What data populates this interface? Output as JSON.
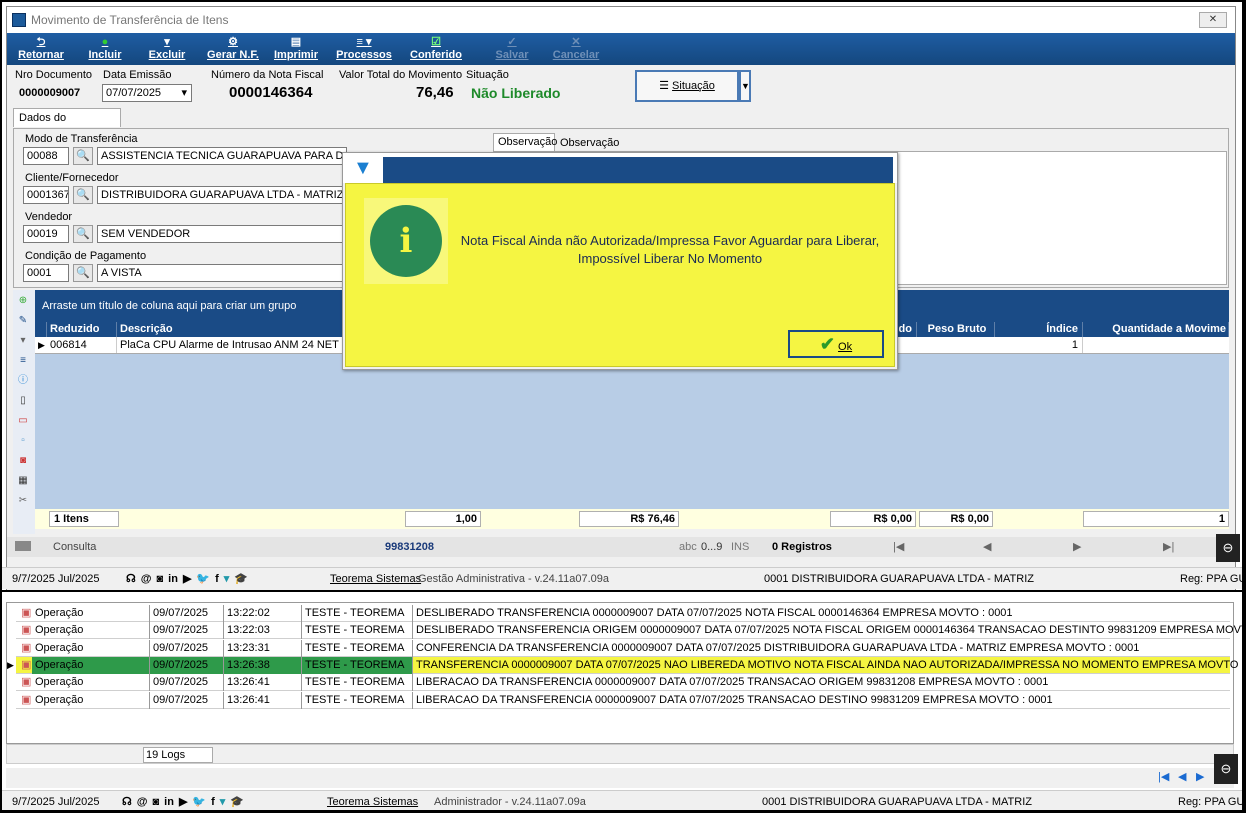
{
  "window": {
    "title": "Movimento de Transferência de Itens",
    "close_label": "✕"
  },
  "toolbar": {
    "retornar": "Retornar",
    "incluir": "Incluir",
    "excluir": "Excluir",
    "gerar_nf": "Gerar N.F.",
    "imprimir": "Imprimir",
    "processos": "Processos",
    "conferido": "Conferido",
    "salvar": "Salvar",
    "cancelar": "Cancelar"
  },
  "header": {
    "nro_documento_label": "Nro Documento",
    "nro_documento": "0000009007",
    "data_emissao_label": "Data Emissão",
    "data_emissao": "07/07/2025",
    "nota_fiscal_label": "Número da Nota Fiscal",
    "nota_fiscal": "0000146364",
    "valor_total_label": "Valor Total do Movimento",
    "valor_total": "76,46",
    "situacao_label": "Situação",
    "situacao": "Não Liberado",
    "situacao_button": "Situação"
  },
  "tabs": {
    "dados_documento": "Dados do Documento",
    "observacao": "Observação",
    "observacao_interna": "Observação Interna"
  },
  "form": {
    "modo_label": "Modo de Transferência",
    "modo_code": "00088",
    "modo_desc": "ASSISTENCIA TECNICA GUARAPUAVA PARA DG MATRIZ",
    "cliente_label": "Cliente/Fornecedor",
    "cliente_code": "0001367",
    "cliente_desc": "DISTRIBUIDORA GUARAPUAVA LTDA - MATRIZ",
    "vendedor_label": "Vendedor",
    "vendedor_code": "00019",
    "vendedor_desc": "SEM VENDEDOR",
    "condicao_label": "Condição de Pagamento",
    "condicao_code": "0001",
    "condicao_desc": "A VISTA"
  },
  "grid": {
    "group_hint": "Arraste um título de coluna aqui para criar um grupo",
    "columns": {
      "reduzido": "Reduzido",
      "descricao": "Descrição",
      "liquido_partial": "uido",
      "peso_bruto": "Peso Bruto",
      "indice": "Índice",
      "quantidade": "Quantidade a Movime"
    },
    "row": {
      "reduzido": "006814",
      "descricao": "PlaCa CPU Alarme de Intrusao ANM 24 NET",
      "indice": "1"
    },
    "footer": {
      "itens": "1 Itens",
      "qtd": "1,00",
      "valor": "R$ 76,46",
      "v1": "R$ 0,00",
      "v2": "R$ 0,00",
      "last": "1"
    }
  },
  "statusbar": {
    "mode": "Consulta",
    "doc": "99831208",
    "abc": "abc",
    "range": "0...9",
    "ins": "INS",
    "registros": "0 Registros"
  },
  "bottombar1": {
    "date": "9/7/2025 Jul/2025",
    "link": "Teorema Sistemas",
    "module": "Gestão Administrativa - v.24.11a07.09a",
    "empresa": "0001 DISTRIBUIDORA GUARAPUAVA LTDA - MATRIZ",
    "reg": "Reg: PPA GU"
  },
  "logs": {
    "rows": [
      {
        "tipo": "Operação",
        "data": "09/07/2025",
        "hora": "13:22:02",
        "usuario": "TESTE - TEOREMA",
        "desc": "DESLIBERADO TRANSFERENCIA 0000009007 DATA 07/07/2025 NOTA FISCAL 0000146364 EMPRESA MOVTO : 0001"
      },
      {
        "tipo": "Operação",
        "data": "09/07/2025",
        "hora": "13:22:03",
        "usuario": "TESTE - TEOREMA",
        "desc": "DESLIBERADO TRANSFERENCIA ORIGEM 0000009007 DATA 07/07/2025 NOTA FISCAL ORIGEM 0000146364 TRANSACAO DESTINTO 99831209 EMPRESA MOVTO : 0001"
      },
      {
        "tipo": "Operação",
        "data": "09/07/2025",
        "hora": "13:23:31",
        "usuario": "TESTE - TEOREMA",
        "desc": "CONFERENCIA DA TRANSFERENCIA 0000009007 DATA 07/07/2025 DISTRIBUIDORA GUARAPUAVA LTDA - MATRIZ EMPRESA MOVTO : 0001"
      },
      {
        "tipo": "Operação",
        "data": "09/07/2025",
        "hora": "13:26:38",
        "usuario": "TESTE - TEOREMA",
        "desc": "TRANSFERENCIA 0000009007 DATA 07/07/2025 NAO LIBEREDA MOTIVO NOTA FISCAL AINDA NAO AUTORIZADA/IMPRESSA NO MOMENTO EMPRESA MOVTO : 0001"
      },
      {
        "tipo": "Operação",
        "data": "09/07/2025",
        "hora": "13:26:41",
        "usuario": "TESTE - TEOREMA",
        "desc": "LIBERACAO DA TRANSFERENCIA 0000009007 DATA 07/07/2025 TRANSACAO ORIGEM 99831208 EMPRESA MOVTO : 0001"
      },
      {
        "tipo": "Operação",
        "data": "09/07/2025",
        "hora": "13:26:41",
        "usuario": "TESTE - TEOREMA",
        "desc": "LIBERACAO DA TRANSFERENCIA 0000009007 DATA 07/07/2025 TRANSACAO DESTINO 99831209 EMPRESA MOVTO : 0001"
      }
    ],
    "count": "19 Logs"
  },
  "bottombar2": {
    "date": "9/7/2025 Jul/2025",
    "link": "Teorema Sistemas",
    "module": "Administrador - v.24.11a07.09a",
    "empresa": "0001 DISTRIBUIDORA GUARAPUAVA LTDA - MATRIZ",
    "reg": "Reg: PPA GU"
  },
  "dialog": {
    "message": "Nota Fiscal Ainda não Autorizada/Impressa Favor Aguardar para Liberar, Impossível Liberar No Momento",
    "ok": "Ok"
  },
  "colors": {
    "toolbar": "#1a4b86",
    "dialog_bg": "#f5f542",
    "info_icon": "#2a8a55",
    "selected_row": "#2e9a4a",
    "situacao": "#1e8a2a"
  }
}
